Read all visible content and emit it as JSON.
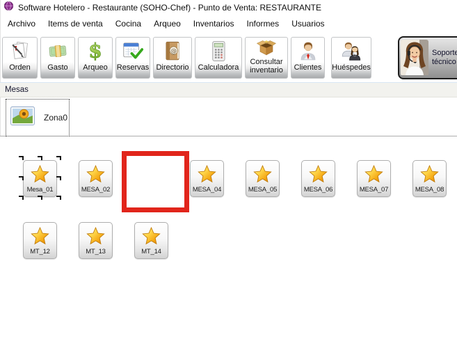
{
  "window": {
    "title": "Software Hotelero - Restaurante (SOHO-Chef) - Punto de Venta: RESTAURANTE",
    "app_icon": "globe-icon"
  },
  "menu": {
    "items": [
      "Archivo",
      "Items de venta",
      "Cocina",
      "Arqueo",
      "Inventarios",
      "Informes",
      "Usuarios"
    ]
  },
  "toolbar": {
    "buttons": [
      {
        "label": "Orden",
        "icon": "order-notepad-icon"
      },
      {
        "label": "Gasto",
        "icon": "money-bundle-icon"
      },
      {
        "label": "Arqueo",
        "icon": "dollar-sign-icon"
      },
      {
        "label": "Reservas",
        "icon": "calendar-check-icon"
      },
      {
        "label": "Directorio",
        "icon": "address-book-icon"
      },
      {
        "label": "Calculadora",
        "icon": "calculator-icon"
      },
      {
        "label": "Consultar inventario",
        "icon": "open-box-icon"
      },
      {
        "label": "Clientes",
        "icon": "client-person-icon"
      },
      {
        "label": "Huéspedes",
        "icon": "guests-people-icon"
      }
    ],
    "support_button": {
      "label": "Soporte técnico",
      "icon": "support-agent-photo"
    }
  },
  "mesas_panel": {
    "title": "Mesas"
  },
  "zones": {
    "tabs": [
      {
        "label": "Zona0",
        "icon": "picture-icon",
        "selected": true
      }
    ]
  },
  "mesas": {
    "items": [
      {
        "label": "Mesa_01",
        "selected": true
      },
      {
        "label": "MESA_02"
      },
      {
        "label": "MESA_04"
      },
      {
        "label": "MESA_05"
      },
      {
        "label": "MESA_06"
      },
      {
        "label": "MESA_07"
      },
      {
        "label": "MESA_08"
      },
      {
        "label": "MT_12"
      },
      {
        "label": "MT_13"
      },
      {
        "label": "MT_14"
      }
    ],
    "highlighted_empty_slot": true
  },
  "colors": {
    "highlight_red": "#e1251b",
    "star_gold": "#f5a915",
    "mesas_bar_bg": "#f2f2ee",
    "support_button_border": "#1c1c1c"
  }
}
